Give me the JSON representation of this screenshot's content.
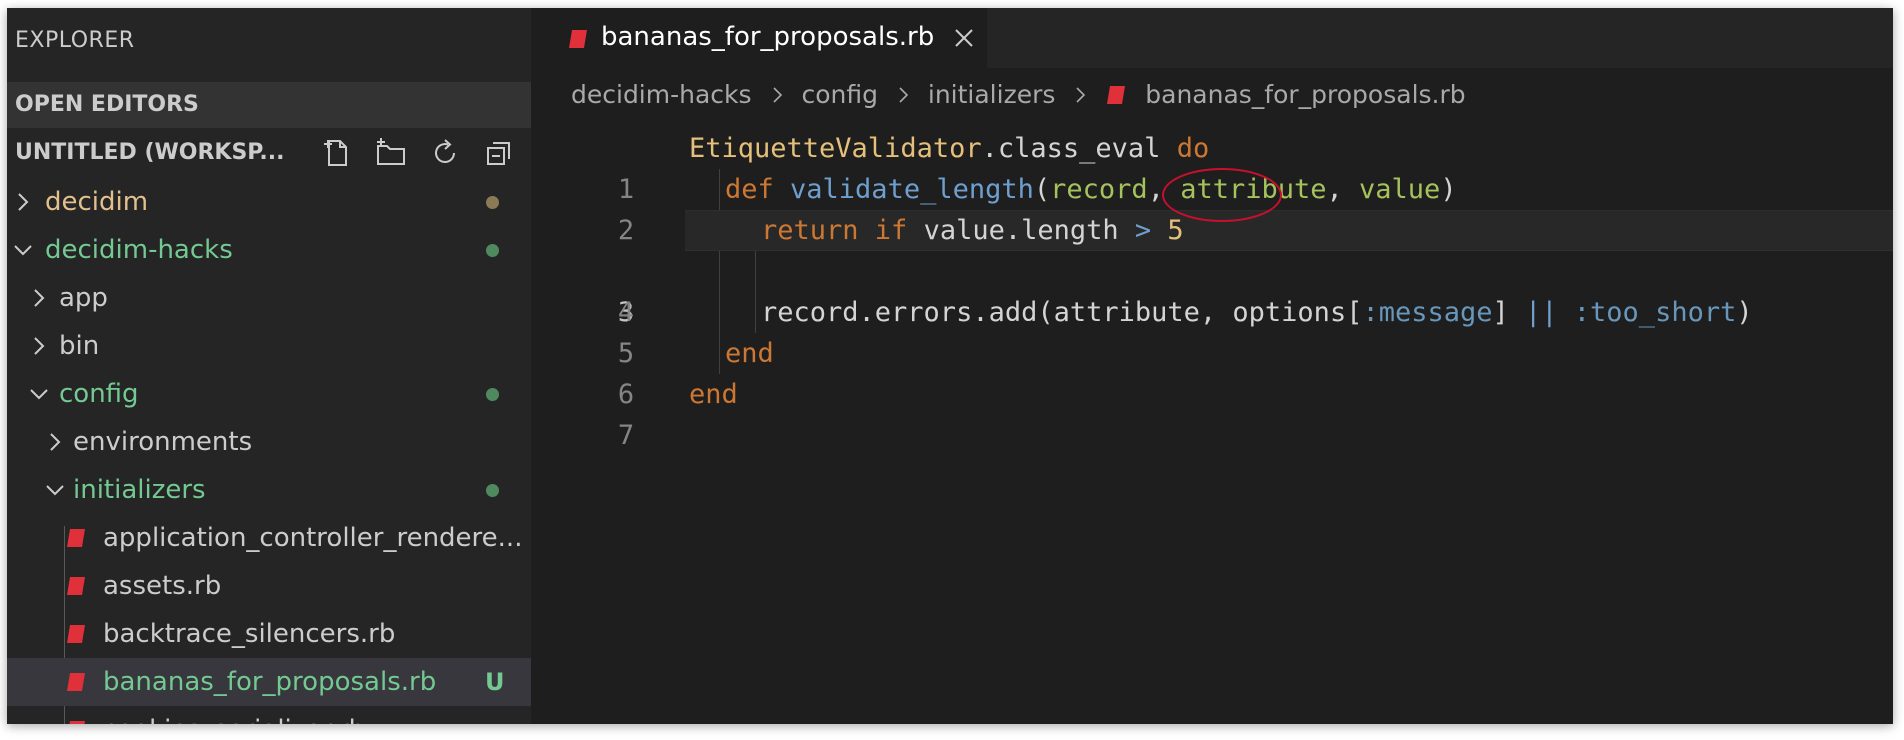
{
  "sidebar": {
    "title": "EXPLORER",
    "open_editors": "OPEN EDITORS",
    "workspace": "UNTITLED (WORKSP...",
    "tree": [
      {
        "label": "decidim",
        "status": "modified-dot"
      },
      {
        "label": "decidim-hacks",
        "status": "added-dot"
      },
      {
        "label": "app"
      },
      {
        "label": "bin"
      },
      {
        "label": "config",
        "status": "added-dot"
      },
      {
        "label": "environments"
      },
      {
        "label": "initializers",
        "status": "added-dot"
      },
      {
        "label": "application_controller_rendere..."
      },
      {
        "label": "assets.rb"
      },
      {
        "label": "backtrace_silencers.rb"
      },
      {
        "label": "bananas_for_proposals.rb",
        "badge": "U"
      },
      {
        "label": "cookies_serializer.rb"
      }
    ],
    "colors": {
      "green": "#73c991",
      "orange": "#e2c08d",
      "ruby": "#e0303a"
    }
  },
  "tab": {
    "label": "bananas_for_proposals.rb"
  },
  "breadcrumb": {
    "items": [
      "decidim-hacks",
      "config",
      "initializers",
      "bananas_for_proposals.rb"
    ]
  },
  "code": {
    "line_numbers": [
      "1",
      "2",
      "3",
      "4",
      "5",
      "6",
      "7"
    ],
    "l1_const": "EtiquetteValidator",
    "l1_rest": ".class_eval ",
    "l1_kw": "do",
    "l2_def": "def ",
    "l2_fn": "validate_length",
    "l2_open": "(",
    "l2_p1": "record",
    "l2_comma1": ", ",
    "l2_p2": "attribute",
    "l2_comma2": ", ",
    "l2_p3": "value",
    "l2_close": ")",
    "l3_ret": "return if ",
    "l3_plain": "value.length ",
    "l3_op": ">",
    "l3_num": "5",
    "l5_plain": "record.errors.add(attribute, options[",
    "l5_sym1": ":message",
    "l5_mid": "] ",
    "l5_or": "||",
    "l5_sym2": " :too_short",
    "l5_end": ")",
    "l6": "end",
    "l7": "end"
  }
}
